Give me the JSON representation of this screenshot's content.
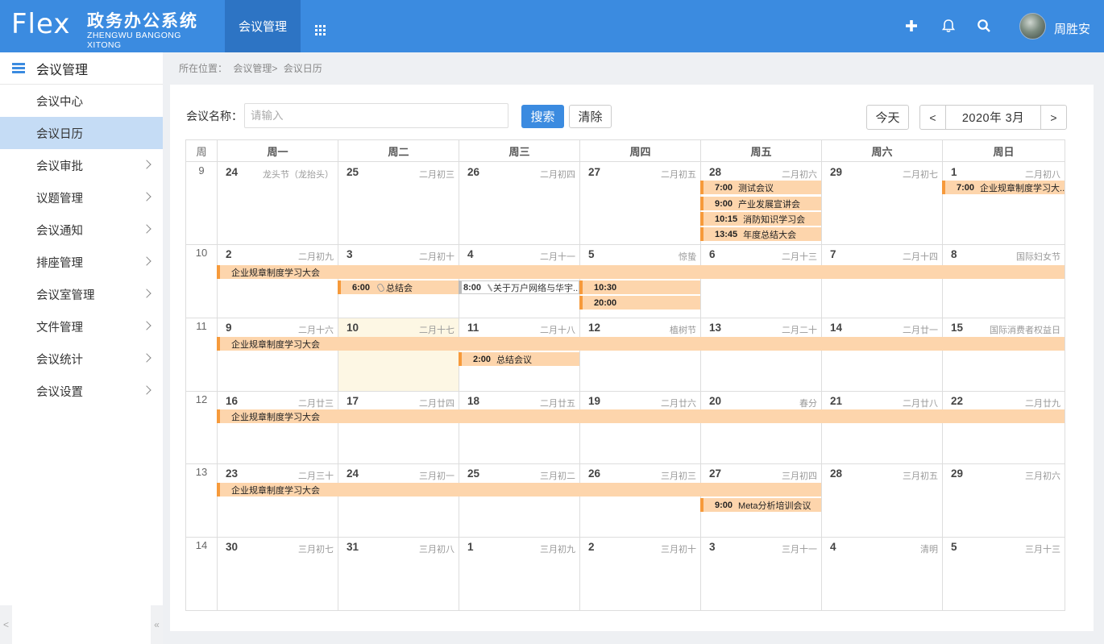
{
  "header": {
    "logo_text": "Flex",
    "title": "政务办公系统",
    "subtitle": "ZHENGWU BANGONG XITONG",
    "active_nav": "会议管理",
    "username": "周胜安",
    "icons": [
      "add-icon",
      "bell-icon",
      "search-icon",
      "grid-icon"
    ],
    "accent": "#3b8be0"
  },
  "sidebar": {
    "title": "会议管理",
    "items": [
      {
        "label": "会议中心",
        "active": false,
        "arrow": false
      },
      {
        "label": "会议日历",
        "active": true,
        "arrow": false
      },
      {
        "label": "会议审批",
        "active": false,
        "arrow": true
      },
      {
        "label": "议题管理",
        "active": false,
        "arrow": true
      },
      {
        "label": "会议通知",
        "active": false,
        "arrow": true
      },
      {
        "label": "排座管理",
        "active": false,
        "arrow": true
      },
      {
        "label": "会议室管理",
        "active": false,
        "arrow": true
      },
      {
        "label": "文件管理",
        "active": false,
        "arrow": true
      },
      {
        "label": "会议统计",
        "active": false,
        "arrow": true
      },
      {
        "label": "会议设置",
        "active": false,
        "arrow": true
      }
    ],
    "footer_left": "<",
    "footer_right": "«"
  },
  "breadcrumb": {
    "prefix": "所在位置：",
    "path1": "会议管理>",
    "path2": "会议日历"
  },
  "toolbar": {
    "search_label": "会议名称：",
    "search_placeholder": "请输入",
    "search_button": "搜索",
    "clear_button": "清除",
    "today_button": "今天",
    "prev": "<",
    "next": ">",
    "month": "2020年 3月"
  },
  "calendar": {
    "week_header": "周",
    "weekdays": [
      "周一",
      "周二",
      "周三",
      "周四",
      "周五",
      "周六",
      "周日"
    ],
    "weeks": [
      {
        "num": "9",
        "days": [
          {
            "d": "24",
            "l": "龙头节（龙抬头）"
          },
          {
            "d": "25",
            "l": "二月初三"
          },
          {
            "d": "26",
            "l": "二月初四"
          },
          {
            "d": "27",
            "l": "二月初五"
          },
          {
            "d": "28",
            "l": "二月初六"
          },
          {
            "d": "29",
            "l": "二月初七"
          },
          {
            "d": "1",
            "l": "二月初八"
          }
        ]
      },
      {
        "num": "10",
        "days": [
          {
            "d": "2",
            "l": "二月初九"
          },
          {
            "d": "3",
            "l": "二月初十"
          },
          {
            "d": "4",
            "l": "二月十一"
          },
          {
            "d": "5",
            "l": "惊蛰"
          },
          {
            "d": "6",
            "l": "二月十三"
          },
          {
            "d": "7",
            "l": "二月十四"
          },
          {
            "d": "8",
            "l": "国际妇女节"
          }
        ]
      },
      {
        "num": "11",
        "days": [
          {
            "d": "9",
            "l": "二月十六"
          },
          {
            "d": "10",
            "l": "二月十七"
          },
          {
            "d": "11",
            "l": "二月十八"
          },
          {
            "d": "12",
            "l": "植树节"
          },
          {
            "d": "13",
            "l": "二月二十"
          },
          {
            "d": "14",
            "l": "二月廿一"
          },
          {
            "d": "15",
            "l": "国际消费者权益日"
          }
        ]
      },
      {
        "num": "12",
        "days": [
          {
            "d": "16",
            "l": "二月廿三"
          },
          {
            "d": "17",
            "l": "二月廿四"
          },
          {
            "d": "18",
            "l": "二月廿五"
          },
          {
            "d": "19",
            "l": "二月廿六"
          },
          {
            "d": "20",
            "l": "春分"
          },
          {
            "d": "21",
            "l": "二月廿八"
          },
          {
            "d": "22",
            "l": "二月廿九"
          }
        ]
      },
      {
        "num": "13",
        "days": [
          {
            "d": "23",
            "l": "二月三十"
          },
          {
            "d": "24",
            "l": "三月初一"
          },
          {
            "d": "25",
            "l": "三月初二"
          },
          {
            "d": "26",
            "l": "三月初三"
          },
          {
            "d": "27",
            "l": "三月初四"
          },
          {
            "d": "28",
            "l": "三月初五"
          },
          {
            "d": "29",
            "l": "三月初六"
          }
        ]
      },
      {
        "num": "14",
        "days": [
          {
            "d": "30",
            "l": "三月初七"
          },
          {
            "d": "31",
            "l": "三月初八"
          },
          {
            "d": "1",
            "l": "三月初九"
          },
          {
            "d": "2",
            "l": "三月初十"
          },
          {
            "d": "3",
            "l": "三月十一"
          },
          {
            "d": "4",
            "l": "清明"
          },
          {
            "d": "5",
            "l": "三月十三"
          }
        ]
      }
    ],
    "events": [
      {
        "time": "7:00",
        "title": "测试会议"
      },
      {
        "time": "9:00",
        "title": "产业发展宣讲会"
      },
      {
        "time": "10:15",
        "title": "消防知识学习会"
      },
      {
        "time": "13:45",
        "title": "年度总结大会"
      },
      {
        "time": "7:00",
        "title": "企业规章制度学习大..."
      },
      {
        "time": "",
        "title": "企业规章制度学习大会"
      },
      {
        "time": "6:00",
        "title": "总结会"
      },
      {
        "time": "8:00",
        "title": "关于万户网络与华宇..."
      },
      {
        "time": "10:30",
        "title": ""
      },
      {
        "time": "20:00",
        "title": ""
      },
      {
        "time": "",
        "title": "企业规章制度学习大会"
      },
      {
        "time": "2:00",
        "title": "总结会议"
      },
      {
        "time": "",
        "title": "企业规章制度学习大会"
      },
      {
        "time": "",
        "title": "企业规章制度学习大会"
      },
      {
        "time": "9:00",
        "title": "Meta分析培训会议"
      }
    ],
    "event_color": "#fdd5ac",
    "event_border": "#f69a3b",
    "today_color": "#fdf7e4"
  }
}
